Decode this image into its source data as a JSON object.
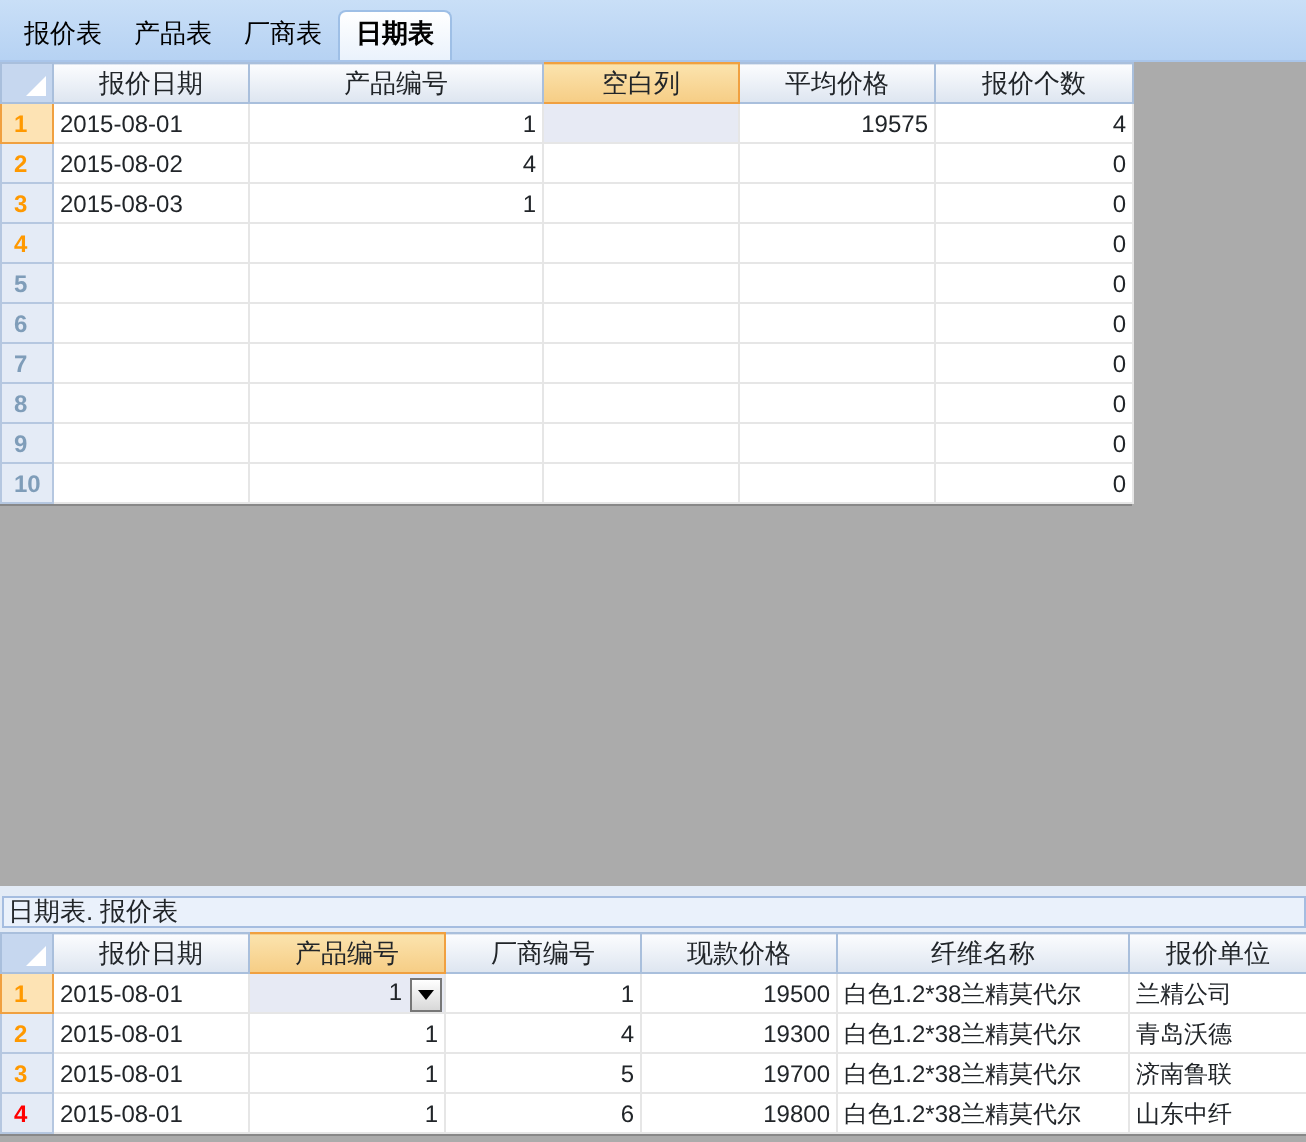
{
  "tabs": [
    {
      "label": "报价表",
      "selected": false
    },
    {
      "label": "产品表",
      "selected": false
    },
    {
      "label": "厂商表",
      "selected": false
    },
    {
      "label": "日期表",
      "selected": true
    }
  ],
  "top_grid": {
    "columns": [
      {
        "label": "报价日期",
        "selected": false,
        "kind": "text"
      },
      {
        "label": "产品编号",
        "selected": false,
        "kind": "number"
      },
      {
        "label": "空白列",
        "selected": true,
        "kind": "text"
      },
      {
        "label": "平均价格",
        "selected": false,
        "kind": "number"
      },
      {
        "label": "报价个数",
        "selected": false,
        "kind": "number"
      }
    ],
    "rows": [
      {
        "number": "1",
        "color": "#ff9900",
        "selected": true,
        "cells": [
          "2015-08-01",
          "1",
          null,
          "19575",
          "4"
        ]
      },
      {
        "number": "2",
        "color": "#ff9900",
        "selected": false,
        "cells": [
          "2015-08-02",
          "4",
          null,
          null,
          "0"
        ]
      },
      {
        "number": "3",
        "color": "#ff9900",
        "selected": false,
        "cells": [
          "2015-08-03",
          "1",
          null,
          null,
          "0"
        ]
      },
      {
        "number": "4",
        "color": "#ff9900",
        "selected": false,
        "cells": [
          null,
          null,
          null,
          null,
          "0"
        ]
      },
      {
        "number": "5",
        "color": "#7f9db9",
        "selected": false,
        "cells": [
          null,
          null,
          null,
          null,
          "0"
        ]
      },
      {
        "number": "6",
        "color": "#7f9db9",
        "selected": false,
        "cells": [
          null,
          null,
          null,
          null,
          "0"
        ]
      },
      {
        "number": "7",
        "color": "#7f9db9",
        "selected": false,
        "cells": [
          null,
          null,
          null,
          null,
          "0"
        ]
      },
      {
        "number": "8",
        "color": "#7f9db9",
        "selected": false,
        "cells": [
          null,
          null,
          null,
          null,
          "0"
        ]
      },
      {
        "number": "9",
        "color": "#7f9db9",
        "selected": false,
        "cells": [
          null,
          null,
          null,
          null,
          "0"
        ]
      },
      {
        "number": "10",
        "color": "#7f9db9",
        "selected": false,
        "cells": [
          null,
          null,
          null,
          null,
          "0"
        ]
      }
    ]
  },
  "bottom_panel": {
    "caption": "日期表. 报价表",
    "grid": {
      "columns": [
        {
          "label": "报价日期",
          "selected": false,
          "kind": "text"
        },
        {
          "label": "产品编号",
          "selected": true,
          "kind": "number"
        },
        {
          "label": "厂商编号",
          "selected": false,
          "kind": "number"
        },
        {
          "label": "现款价格",
          "selected": false,
          "kind": "number"
        },
        {
          "label": "纤维名称",
          "selected": false,
          "kind": "text"
        },
        {
          "label": "报价单位",
          "selected": false,
          "kind": "text"
        }
      ],
      "editor_dropdown": true,
      "rows": [
        {
          "number": "1",
          "color": "#ff9900",
          "selected": true,
          "cells": [
            "2015-08-01",
            "1",
            "1",
            "19500",
            "白色1.2*38兰精莫代尔",
            "兰精公司"
          ]
        },
        {
          "number": "2",
          "color": "#ff9900",
          "selected": false,
          "cells": [
            "2015-08-01",
            "1",
            "4",
            "19300",
            "白色1.2*38兰精莫代尔",
            "青岛沃德"
          ]
        },
        {
          "number": "3",
          "color": "#ff9900",
          "selected": false,
          "cells": [
            "2015-08-01",
            "1",
            "5",
            "19700",
            "白色1.2*38兰精莫代尔",
            "济南鲁联"
          ]
        },
        {
          "number": "4",
          "color": "#ff0000",
          "selected": false,
          "cells": [
            "2015-08-01",
            "1",
            "6",
            "19800",
            "白色1.2*38兰精莫代尔",
            "山东中纤"
          ]
        }
      ]
    }
  }
}
